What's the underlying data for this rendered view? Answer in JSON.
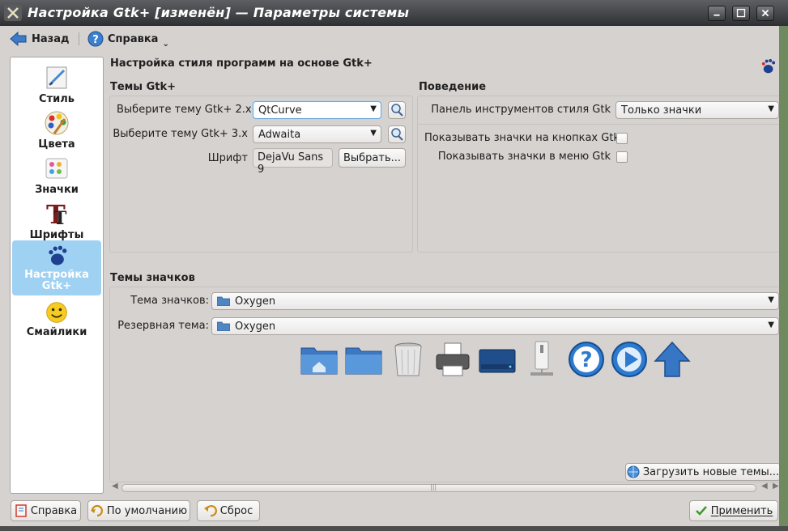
{
  "window": {
    "title": "Настройка Gtk+ [изменён] — Параметры системы"
  },
  "toolbar": {
    "back_label": "Назад",
    "help_label": "Справка"
  },
  "sidebar": {
    "items": [
      {
        "label": "Стиль",
        "icon": "style-icon"
      },
      {
        "label": "Цвета",
        "icon": "colors-icon"
      },
      {
        "label": "Значки",
        "icon": "icons-icon"
      },
      {
        "label": "Шрифты",
        "icon": "fonts-icon"
      },
      {
        "label": "Настройка\nGtk+",
        "icon": "gnome-foot-icon",
        "active": true
      },
      {
        "label": "Смайлики",
        "icon": "smiley-icon"
      }
    ]
  },
  "main": {
    "header": "Настройка стиля программ на основе Gtk+",
    "gtk_themes": {
      "title": "Темы Gtk+",
      "gtk2_label": "Выберите тему Gtk+ 2.x",
      "gtk2_value": "QtCurve",
      "gtk3_label": "Выберите тему Gtk+ 3.x",
      "gtk3_value": "Adwaita",
      "font_label": "Шрифт",
      "font_value": "DejaVu Sans 9",
      "choose_button": "Выбрать..."
    },
    "behavior": {
      "title": "Поведение",
      "toolbar_style_label": "Панель инструментов стиля Gtk",
      "toolbar_style_value": "Только значки",
      "show_button_icons_label": "Показывать значки на кнопках Gtk",
      "show_button_icons_checked": false,
      "show_menu_icons_label": "Показывать значки в меню Gtk",
      "show_menu_icons_checked": false
    },
    "icon_themes": {
      "title": "Темы значков",
      "theme_label": "Тема значков:",
      "theme_value": "Oxygen",
      "fallback_label": "Резервная тема:",
      "fallback_value": "Oxygen",
      "preview_icons": [
        "folder-home-icon",
        "folder-icon",
        "trash-icon",
        "printer-icon",
        "drive-icon",
        "computer-tower-icon",
        "help-icon",
        "media-play-icon",
        "up-arrow-icon"
      ],
      "download_button": "Загрузить новые темы..."
    }
  },
  "footer": {
    "help_button": "Справка",
    "defaults_button": "По умолчанию",
    "reset_button": "Сброс",
    "apply_button": "Применить"
  },
  "colors": {
    "window_bg": "#d6d2d0",
    "selection": "#9fd1f3",
    "titlebar": "#3b3c3f"
  }
}
